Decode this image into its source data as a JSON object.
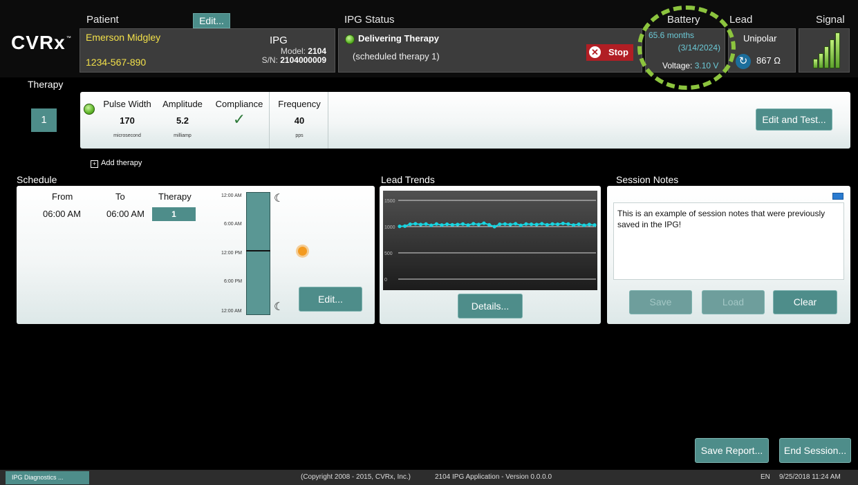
{
  "header": {
    "logo": "CVRx",
    "logo_tm": "™",
    "patient_title": "Patient",
    "edit_label": "Edit...",
    "status_title": "IPG Status",
    "battery_title": "Battery",
    "lead_title": "Lead",
    "signal_title": "Signal"
  },
  "patient": {
    "name": "Emerson Midgley",
    "id": "1234-567-890",
    "ipg_label": "IPG",
    "model_label": "Model:",
    "model": "2104",
    "sn_label": "S/N:",
    "sn": "2104000009"
  },
  "status": {
    "main": "Delivering Therapy",
    "sub": "(scheduled therapy 1)",
    "stop_label": "Stop",
    "status_color": "#5fb52a"
  },
  "battery": {
    "months": "65.6 months",
    "date": "(3/14/2024)",
    "voltage_label": "Voltage:",
    "voltage": "3.10 V"
  },
  "lead": {
    "type": "Unipolar",
    "impedance": "867 Ω"
  },
  "signal": {
    "level": 5,
    "max": 5
  },
  "therapy": {
    "title": "Therapy",
    "number": "1",
    "columns": [
      {
        "header": "Pulse Width",
        "value": "170",
        "unit": "microsecond"
      },
      {
        "header": "Amplitude",
        "value": "5.2",
        "unit": "milliamp"
      },
      {
        "header": "Compliance",
        "value": "✓",
        "unit": ""
      },
      {
        "header": "Frequency",
        "value": "40",
        "unit": "pps"
      }
    ],
    "edit_test_label": "Edit and Test...",
    "add_label": "Add therapy"
  },
  "schedule": {
    "title": "Schedule",
    "headers": {
      "from": "From",
      "to": "To",
      "therapy": "Therapy"
    },
    "rows": [
      {
        "from": "06:00 AM",
        "to": "06:00 AM",
        "therapy": "1"
      }
    ],
    "timeline_labels": [
      "12:00 AM",
      "6:00 AM",
      "12:00 PM",
      "6:00 PM",
      "12:00 AM"
    ],
    "edit_label": "Edit..."
  },
  "lead_trends": {
    "title": "Lead Trends",
    "details_label": "Details...",
    "y_ticks": [
      "1500",
      "1000",
      "500",
      "0"
    ]
  },
  "chart_data": {
    "type": "line",
    "title": "",
    "ylim": [
      0,
      1500
    ],
    "yticks": [
      0,
      500,
      1000,
      1500
    ],
    "series": [
      {
        "name": "",
        "color": "#18d4e0",
        "values": [
          1005,
          1010,
          1045,
          1055,
          1040,
          1050,
          1025,
          1050,
          1030,
          1045,
          1035,
          1040,
          1050,
          1030,
          1055,
          1040,
          1065,
          1035,
          1000,
          1045,
          1050,
          1040,
          1055,
          1025,
          1050,
          1045,
          1040,
          1055,
          1035,
          1050,
          1045,
          1060,
          1050,
          1030,
          1045,
          1025,
          1040,
          1030
        ]
      }
    ]
  },
  "notes": {
    "title": "Session Notes",
    "text": "This is an example of session notes that were previously saved in the IPG!",
    "save_label": "Save",
    "load_label": "Load",
    "clear_label": "Clear"
  },
  "actions": {
    "save_report": "Save Report...",
    "end_session": "End Session..."
  },
  "footer": {
    "task": "IPG Diagnostics ...",
    "copyright": "(Copyright 2008 - 2015, CVRx, Inc.)",
    "app": "2104 IPG Application - Version 0.0.0.0",
    "lang": "EN",
    "datetime": "9/25/2018 11:24 AM"
  },
  "colors": {
    "accent_teal": "#4e8d8a",
    "patient_text": "#f2e04a",
    "battery_text": "#6cc9d6",
    "highlight": "#8cc43e"
  }
}
